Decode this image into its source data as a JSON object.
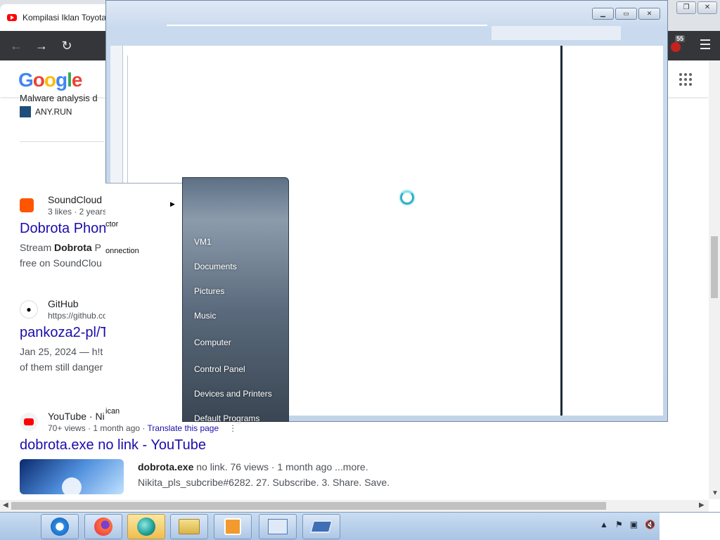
{
  "browser": {
    "tab_title": "Kompilasi Iklan Toyota",
    "extension_badge": "55",
    "nav": {
      "back": "←",
      "forward": "→",
      "reload": "↻"
    }
  },
  "google": {
    "logo": [
      "G",
      "o",
      "o",
      "g",
      "l",
      "e"
    ],
    "results": [
      {
        "snippet_top": "Malware analysis d",
        "source": "ANY.RUN"
      },
      {
        "source": "SoundCloud",
        "meta": "3 likes · 2 years",
        "title": "Dobrota Phon",
        "snippet_1_pre": "Stream ",
        "snippet_1_bold": "Dobrota",
        "snippet_1_post": " P",
        "snippet_2": "free on SoundClou"
      },
      {
        "source": "GitHub",
        "meta": "https://github.co",
        "title": "pankoza2-pl/T",
        "snippet_1": "Jan 25, 2024 — h!t",
        "snippet_2": "of them still danger"
      },
      {
        "source": "YouTube · Ni",
        "meta": "70+ views · 1 month ago · ",
        "translate": "Translate this page",
        "title": "dobrota.exe no link - YouTube",
        "snippet_bold": "dobrota.exe",
        "snippet_1": " no link. 76 views · 1 month ago ...more.",
        "snippet_2": "Nikita_pls_subcribe#6282. 27. Subscribe. 3. Share. Save."
      }
    ]
  },
  "start_menu": {
    "left_fragments": [
      "ctor",
      "onnection",
      "ican"
    ],
    "items": [
      "VM1",
      "Documents",
      "Pictures",
      "Music",
      "Computer",
      "Control Panel",
      "Devices and Printers",
      "Default Programs"
    ]
  },
  "taskbar": {
    "buttons": [
      "internet-explorer-icon",
      "firefox-icon",
      "app-icon",
      "explorer-icon",
      "media-player-icon",
      "control-panel-icon",
      "remote-icon"
    ],
    "active_index": 2
  }
}
